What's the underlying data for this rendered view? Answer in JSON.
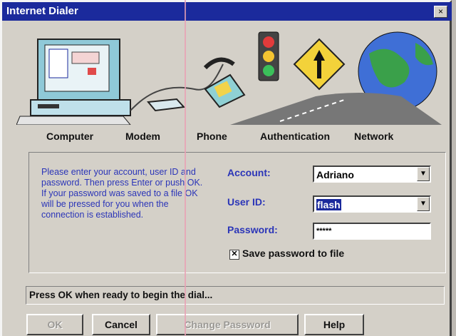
{
  "window": {
    "title": "Internet Dialer",
    "close_glyph": "×"
  },
  "banner": {
    "icons": [
      "computer-illustration",
      "modem-illustration",
      "phone-illustration",
      "traffic-light-icon",
      "road-sign-icon",
      "globe-icon"
    ],
    "stages": [
      "Computer",
      "Modem",
      "Phone",
      "Authentication",
      "Network"
    ]
  },
  "info_text": "Please enter your account, user ID and password. Then press Enter or push OK. If your password was saved to a file OK will be pressed for you when the connection is established.",
  "form": {
    "account_label": "Account:",
    "account_value": "Adriano",
    "userid_label": "User ID:",
    "userid_value": "flash",
    "password_label": "Password:",
    "password_value": "*****",
    "save_checked": true,
    "save_label": "Save password to file"
  },
  "status_text": "Press OK when ready to begin the dial...",
  "buttons": {
    "ok": "OK",
    "cancel": "Cancel",
    "change_password": "Change Password",
    "help": "Help"
  },
  "colors": {
    "title_bar": "#1b2a9c",
    "label_blue": "#2b35b8",
    "dialog_bg": "#d4d0c8"
  }
}
